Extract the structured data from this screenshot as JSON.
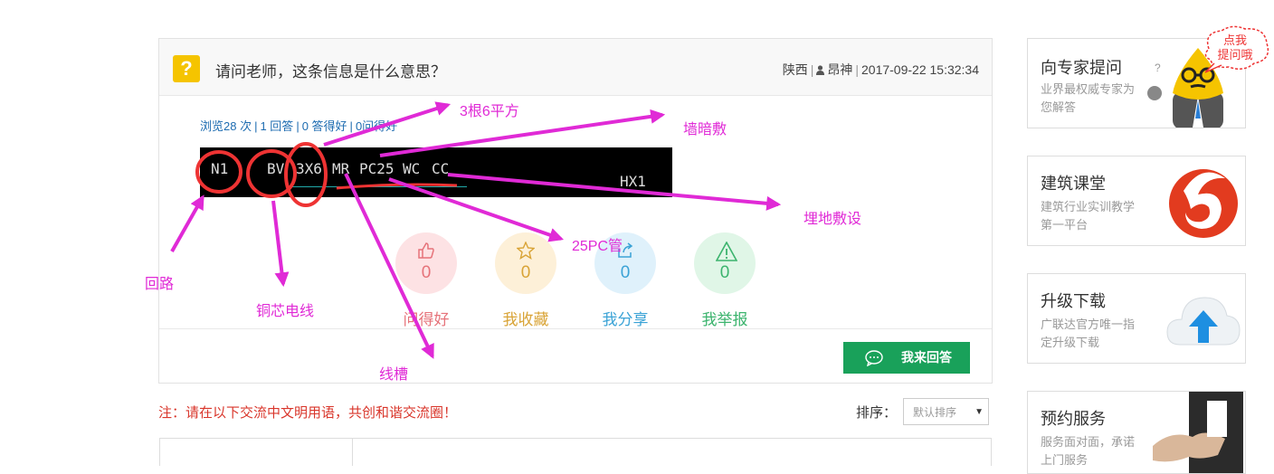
{
  "question": {
    "title": "请问老师，这条信息是什么意思？",
    "location": "陕西",
    "author": "昂神",
    "datetime": "2017-09-22 15:32:34",
    "stats": {
      "views": "浏览28 次",
      "answers": "1 回答",
      "answered_good": "0 答得好",
      "asked_good": "0问得好"
    }
  },
  "cad_image": {
    "circuit": "N1",
    "cable": "BV",
    "spec": "3X6",
    "tray": "MR",
    "pipe": "PC25",
    "wall": "WC",
    "ceiling": "CC",
    "box": "HX1"
  },
  "annotations": {
    "loop": "回路",
    "copper_wire": "铜芯电线",
    "three_six": "3根6平方",
    "wall_conceal": "墙暗敷",
    "floor_lay": "埋地敷设",
    "pc_pipe": "25PC管",
    "trunking": "线槽"
  },
  "actions": [
    {
      "label": "问得好",
      "count": "0",
      "icon": "thumbs-up-icon",
      "color": "#e6737a",
      "bg": "#fde2e4"
    },
    {
      "label": "我收藏",
      "count": "0",
      "icon": "star-icon",
      "color": "#d9a437",
      "bg": "#fdf0d8"
    },
    {
      "label": "我分享",
      "count": "0",
      "icon": "share-icon",
      "color": "#3ba3d6",
      "bg": "#dff1fb"
    },
    {
      "label": "我举报",
      "count": "0",
      "icon": "warning-icon",
      "color": "#3cb46e",
      "bg": "#e0f6e7"
    }
  ],
  "answer_button": "我来回答",
  "notice": "注：请在以下交流中文明用语，共创和谐交流圈！",
  "sort": {
    "label": "排序：",
    "selected": "默认排序"
  },
  "sidebar": [
    {
      "title": "向专家提问",
      "desc": "业界最权威专家为您解答",
      "badge": "点我\n提问哦"
    },
    {
      "title": "建筑课堂",
      "desc": "建筑行业实训教学第一平台"
    },
    {
      "title": "升级下载",
      "desc": "广联达官方唯一指定升级下载"
    },
    {
      "title": "预约服务",
      "desc": "服务面对面，承诺上门服务"
    }
  ],
  "colors": {
    "accent_green": "#19a15a",
    "annotation": "#e02ad6",
    "notice_red": "#d9362b",
    "link_blue": "#1c6bb0"
  }
}
